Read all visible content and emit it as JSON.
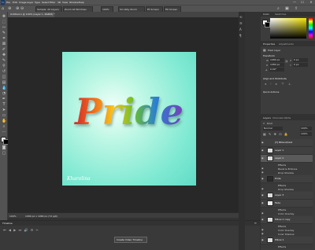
{
  "app": {
    "menus": [
      "File",
      "Edit",
      "Image",
      "Layer",
      "Type",
      "Select",
      "Filter",
      "3D",
      "View",
      "Window",
      "Help"
    ],
    "window_controls": [
      "—",
      "☐",
      "✕"
    ]
  },
  "options_bar": {
    "sample_mode": "Sample: All Layers",
    "size_field": "100%",
    "zoom_all_windows": "Zoom All Windows",
    "scrubby_zoom": "Scrubby Zoom",
    "fit_screen": "Fit Screen",
    "fill_screen": "Fill Screen"
  },
  "document": {
    "tab_title": "Untitled-1 @ 100% (Layer 1, RGB/8) *",
    "artwork_text": "Pride",
    "signature": "Kharolina"
  },
  "status": {
    "zoom": "100%",
    "doc_info": "1080 px x 1080 px (72 ppi)"
  },
  "timeline": {
    "title": "Timeline",
    "create_button": "Create Video Timeline"
  },
  "right_panels": {
    "color": {
      "tabs": [
        "Color",
        "Swatches"
      ],
      "fg_color": "#ffffff",
      "bg_color": "#000000"
    },
    "properties": {
      "tabs": [
        "Properties",
        "Adjustments"
      ],
      "kind": "Pixel Layer",
      "transform_title": "Transform",
      "w_label": "W",
      "w_value": "1080 px",
      "h_label": "H",
      "h_value": "1080 px",
      "x_label": "X",
      "x_value": "0 px",
      "y_label": "Y",
      "y_value": "0 px",
      "angle": "0.00°",
      "align_title": "Align and Distribute",
      "quick_actions_title": "Quick Actions"
    },
    "layers": {
      "tabs": [
        "Layers",
        "Channels",
        "Paths"
      ],
      "kind_filter": "Kind",
      "blend_mode": "Normal",
      "opacity": "100%",
      "fill": "100%",
      "items": [
        {
          "name": "[T] BKGnd/text",
          "type": "text"
        },
        {
          "name": "Layer 1",
          "type": "pixel"
        },
        {
          "name": "Layer 2",
          "type": "pixel",
          "selected": true
        },
        {
          "name": "Effects",
          "type": "sub"
        },
        {
          "name": "Bevel & Emboss",
          "type": "sub"
        },
        {
          "name": "Drop Shadow",
          "type": "sub"
        },
        {
          "name": "Pride",
          "type": "text"
        },
        {
          "name": "Effects",
          "type": "sub"
        },
        {
          "name": "Drop Shadow",
          "type": "sub"
        },
        {
          "name": "Layer 3",
          "type": "pixel"
        },
        {
          "name": "Fade",
          "type": "pixel"
        },
        {
          "name": "Effects",
          "type": "sub"
        },
        {
          "name": "Color Overlay",
          "type": "sub"
        },
        {
          "name": "Pillow 1 copy",
          "type": "pixel"
        },
        {
          "name": "Effects",
          "type": "sub"
        },
        {
          "name": "Color Overlay",
          "type": "sub"
        },
        {
          "name": "Inner Shadow",
          "type": "sub"
        },
        {
          "name": "Pillow 1",
          "type": "pixel"
        },
        {
          "name": "Effects",
          "type": "sub"
        },
        {
          "name": "Color Overlay",
          "type": "sub"
        },
        {
          "name": "Drop Shadow",
          "type": "sub"
        }
      ]
    }
  }
}
